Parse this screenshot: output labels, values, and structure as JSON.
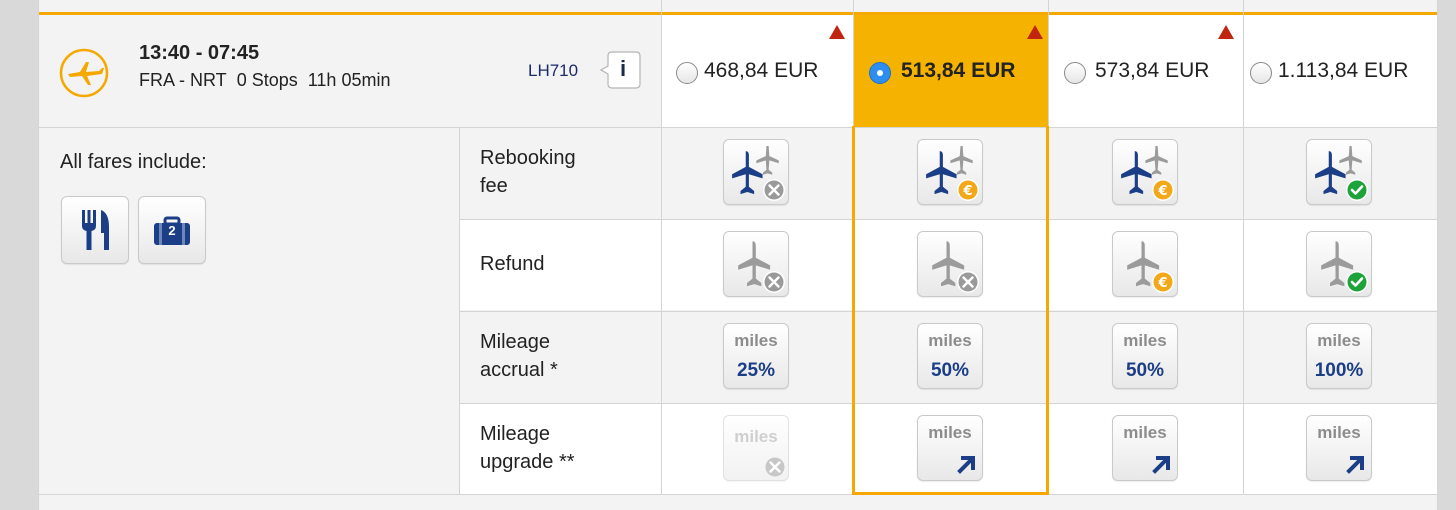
{
  "flight": {
    "times": "13:40 - 07:45",
    "route": "FRA - NRT",
    "stops": "0 Stops",
    "duration": "11h 05min",
    "flight_number": "LH710",
    "info_label": "i"
  },
  "fares": [
    {
      "price": "468,84 EUR",
      "selected": false
    },
    {
      "price": "513,84 EUR",
      "selected": true
    },
    {
      "price": "573,84 EUR",
      "selected": false
    },
    {
      "price": "1.113,84 EUR",
      "selected": false
    }
  ],
  "included": {
    "label": "All fares include:",
    "baggage_count": "2"
  },
  "rows": {
    "rebooking": {
      "line1": "Rebooking",
      "line2": "fee"
    },
    "refund": {
      "line1": "Refund"
    },
    "accrual": {
      "line1": "Mileage",
      "line2": "accrual *"
    },
    "upgrade": {
      "line1": "Mileage",
      "line2": "upgrade **"
    }
  },
  "miles_word": "miles",
  "accrual_values": [
    "25%",
    "50%",
    "50%",
    "100%"
  ],
  "colors": {
    "accent": "#f5a800",
    "navy": "#1b3e86",
    "triangle": "#c0260f",
    "euro": "#f2a818",
    "check": "#1ea33b",
    "cross": "#9a9a9a"
  }
}
